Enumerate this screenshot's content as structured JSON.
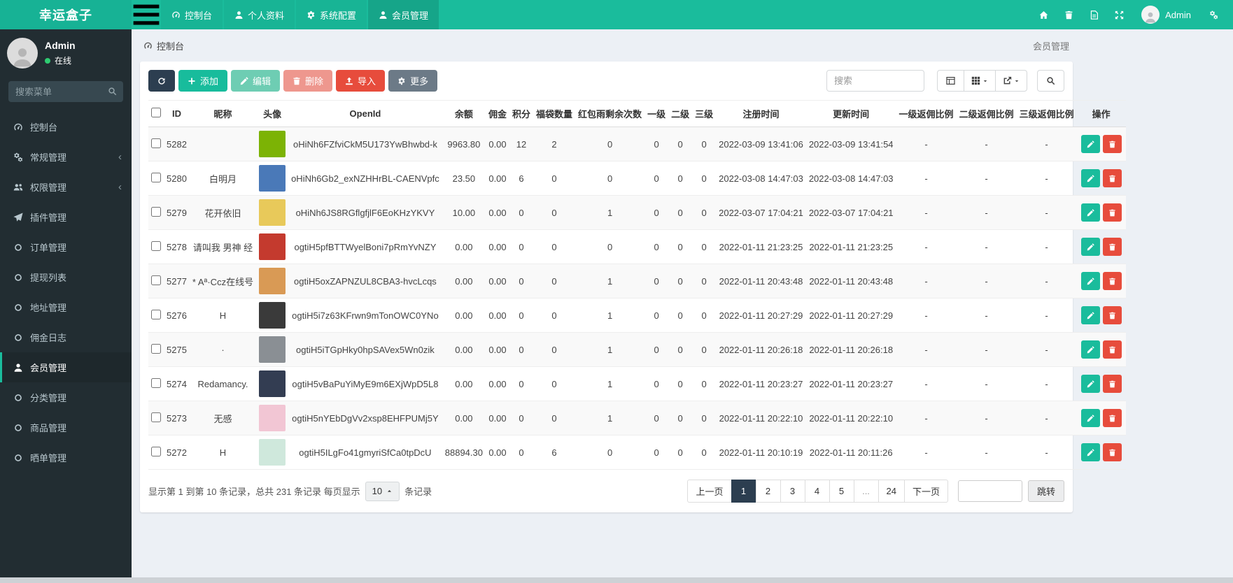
{
  "navbar": {
    "brand": "幸运盒子",
    "tabs": [
      {
        "label": "控制台",
        "icon": "tachometer",
        "active": false
      },
      {
        "label": "个人资料",
        "icon": "user",
        "active": false
      },
      {
        "label": "系统配置",
        "icon": "gear",
        "active": false
      },
      {
        "label": "会员管理",
        "icon": "user",
        "active": true
      }
    ],
    "right_icons": [
      "home",
      "trash",
      "file",
      "expand"
    ],
    "user": "Admin"
  },
  "sidebar": {
    "user": {
      "name": "Admin",
      "status": "在线"
    },
    "search_placeholder": "搜索菜单",
    "items": [
      {
        "label": "控制台",
        "icon": "tachometer",
        "active": false,
        "chevron": false
      },
      {
        "label": "常规管理",
        "icon": "cogs",
        "active": false,
        "chevron": true
      },
      {
        "label": "权限管理",
        "icon": "users",
        "active": false,
        "chevron": true
      },
      {
        "label": "插件管理",
        "icon": "plane",
        "active": false,
        "chevron": false
      },
      {
        "label": "订单管理",
        "icon": "circle",
        "active": false,
        "chevron": false
      },
      {
        "label": "提现列表",
        "icon": "circle",
        "active": false,
        "chevron": false
      },
      {
        "label": "地址管理",
        "icon": "circle",
        "active": false,
        "chevron": false
      },
      {
        "label": "佣金日志",
        "icon": "circle",
        "active": false,
        "chevron": false
      },
      {
        "label": "会员管理",
        "icon": "user",
        "active": true,
        "chevron": false
      },
      {
        "label": "分类管理",
        "icon": "circle",
        "active": false,
        "chevron": false
      },
      {
        "label": "商品管理",
        "icon": "circle",
        "active": false,
        "chevron": false
      },
      {
        "label": "晒单管理",
        "icon": "circle",
        "active": false,
        "chevron": false
      }
    ]
  },
  "breadcrumb": {
    "left": "控制台",
    "right": "会员管理"
  },
  "toolbar": {
    "add": "添加",
    "edit": "编辑",
    "delete": "删除",
    "import": "导入",
    "more": "更多",
    "search_placeholder": "搜索"
  },
  "table": {
    "headers": [
      "ID",
      "昵称",
      "头像",
      "OpenId",
      "余额",
      "佣金",
      "积分",
      "福袋数量",
      "红包雨剩余次数",
      "一级",
      "二级",
      "三级",
      "注册时间",
      "更新时间",
      "一级返佣比例",
      "二级返佣比例",
      "三级返佣比例",
      "操作"
    ],
    "rows": [
      {
        "id": "5282",
        "nickname": "",
        "avatar_color": "#7cb305",
        "openid": "oHiNh6FZfviCkM5U173YwBhwbd-k",
        "balance": "9963.80",
        "commission": "0.00",
        "points": "12",
        "lucky_bags": "2",
        "red_rain_left": "0",
        "level1": "0",
        "level2": "0",
        "level3": "0",
        "register_time": "2022-03-09 13:41:06",
        "update_time": "2022-03-09 13:41:54",
        "rebate1": "-",
        "rebate2": "-",
        "rebate3": "-"
      },
      {
        "id": "5280",
        "nickname": "白明月",
        "avatar_color": "#4a79b8",
        "openid": "oHiNh6Gb2_exNZHHrBL-CAENVpfc",
        "balance": "23.50",
        "commission": "0.00",
        "points": "6",
        "lucky_bags": "0",
        "red_rain_left": "0",
        "level1": "0",
        "level2": "0",
        "level3": "0",
        "register_time": "2022-03-08 14:47:03",
        "update_time": "2022-03-08 14:47:03",
        "rebate1": "-",
        "rebate2": "-",
        "rebate3": "-"
      },
      {
        "id": "5279",
        "nickname": "花开依旧",
        "avatar_color": "#e8c95a",
        "openid": "oHiNh6JS8RGflgfjlF6EoKHzYKVY",
        "balance": "10.00",
        "commission": "0.00",
        "points": "0",
        "lucky_bags": "0",
        "red_rain_left": "1",
        "level1": "0",
        "level2": "0",
        "level3": "0",
        "register_time": "2022-03-07 17:04:21",
        "update_time": "2022-03-07 17:04:21",
        "rebate1": "-",
        "rebate2": "-",
        "rebate3": "-"
      },
      {
        "id": "5278",
        "nickname": "请叫我 男神 经",
        "avatar_color": "#c43a2e",
        "openid": "ogtiH5pfBTTWyelBoni7pRmYvNZY",
        "balance": "0.00",
        "commission": "0.00",
        "points": "0",
        "lucky_bags": "0",
        "red_rain_left": "0",
        "level1": "0",
        "level2": "0",
        "level3": "0",
        "register_time": "2022-01-11 21:23:25",
        "update_time": "2022-01-11 21:23:25",
        "rebate1": "-",
        "rebate2": "-",
        "rebate3": "-"
      },
      {
        "id": "5277",
        "nickname": "* Aª·Ccz在线号",
        "avatar_color": "#d99a55",
        "openid": "ogtiH5oxZAPNZUL8CBA3-hvcLcqs",
        "balance": "0.00",
        "commission": "0.00",
        "points": "0",
        "lucky_bags": "0",
        "red_rain_left": "1",
        "level1": "0",
        "level2": "0",
        "level3": "0",
        "register_time": "2022-01-11 20:43:48",
        "update_time": "2022-01-11 20:43:48",
        "rebate1": "-",
        "rebate2": "-",
        "rebate3": "-"
      },
      {
        "id": "5276",
        "nickname": "H",
        "avatar_color": "#3a3a3a",
        "openid": "ogtiH5i7z63KFrwn9mTonOWC0YNo",
        "balance": "0.00",
        "commission": "0.00",
        "points": "0",
        "lucky_bags": "0",
        "red_rain_left": "1",
        "level1": "0",
        "level2": "0",
        "level3": "0",
        "register_time": "2022-01-11 20:27:29",
        "update_time": "2022-01-11 20:27:29",
        "rebate1": "-",
        "rebate2": "-",
        "rebate3": "-"
      },
      {
        "id": "5275",
        "nickname": "·",
        "avatar_color": "#8a8f94",
        "openid": "ogtiH5iTGpHky0hpSAVex5Wn0zik",
        "balance": "0.00",
        "commission": "0.00",
        "points": "0",
        "lucky_bags": "0",
        "red_rain_left": "1",
        "level1": "0",
        "level2": "0",
        "level3": "0",
        "register_time": "2022-01-11 20:26:18",
        "update_time": "2022-01-11 20:26:18",
        "rebate1": "-",
        "rebate2": "-",
        "rebate3": "-"
      },
      {
        "id": "5274",
        "nickname": "Redamancy.",
        "avatar_color": "#333d52",
        "openid": "ogtiH5vBaPuYiMyE9m6EXjWpD5L8",
        "balance": "0.00",
        "commission": "0.00",
        "points": "0",
        "lucky_bags": "0",
        "red_rain_left": "1",
        "level1": "0",
        "level2": "0",
        "level3": "0",
        "register_time": "2022-01-11 20:23:27",
        "update_time": "2022-01-11 20:23:27",
        "rebate1": "-",
        "rebate2": "-",
        "rebate3": "-"
      },
      {
        "id": "5273",
        "nickname": "无感",
        "avatar_color": "#f2c6d4",
        "openid": "ogtiH5nYEbDgVv2xsp8EHFPUMj5Y",
        "balance": "0.00",
        "commission": "0.00",
        "points": "0",
        "lucky_bags": "0",
        "red_rain_left": "1",
        "level1": "0",
        "level2": "0",
        "level3": "0",
        "register_time": "2022-01-11 20:22:10",
        "update_time": "2022-01-11 20:22:10",
        "rebate1": "-",
        "rebate2": "-",
        "rebate3": "-"
      },
      {
        "id": "5272",
        "nickname": "H",
        "avatar_color": "#cfe8dc",
        "openid": "ogtiH5ILgFo41gmyriSfCa0tpDcU",
        "balance": "88894.30",
        "commission": "0.00",
        "points": "0",
        "lucky_bags": "6",
        "red_rain_left": "0",
        "level1": "0",
        "level2": "0",
        "level3": "0",
        "register_time": "2022-01-11 20:10:19",
        "update_time": "2022-01-11 20:11:26",
        "rebate1": "-",
        "rebate2": "-",
        "rebate3": "-"
      }
    ]
  },
  "pagination": {
    "info_prefix": "显示第 1 到第 10 条记录，总共 231 条记录 每页显示",
    "page_size": "10",
    "info_suffix": "条记录",
    "prev": "上一页",
    "next": "下一页",
    "pages": [
      "1",
      "2",
      "3",
      "4",
      "5",
      "...",
      "24"
    ],
    "active_page": "1",
    "jump_value": "",
    "jump_label": "跳转"
  },
  "colors": {
    "navbar_green": "#1abc9c",
    "sidebar_dark": "#222d32",
    "primary": "#18bc9c",
    "danger": "#e74c3c",
    "dark_navy": "#2c3e50",
    "content_bg": "#ecf0f5"
  }
}
